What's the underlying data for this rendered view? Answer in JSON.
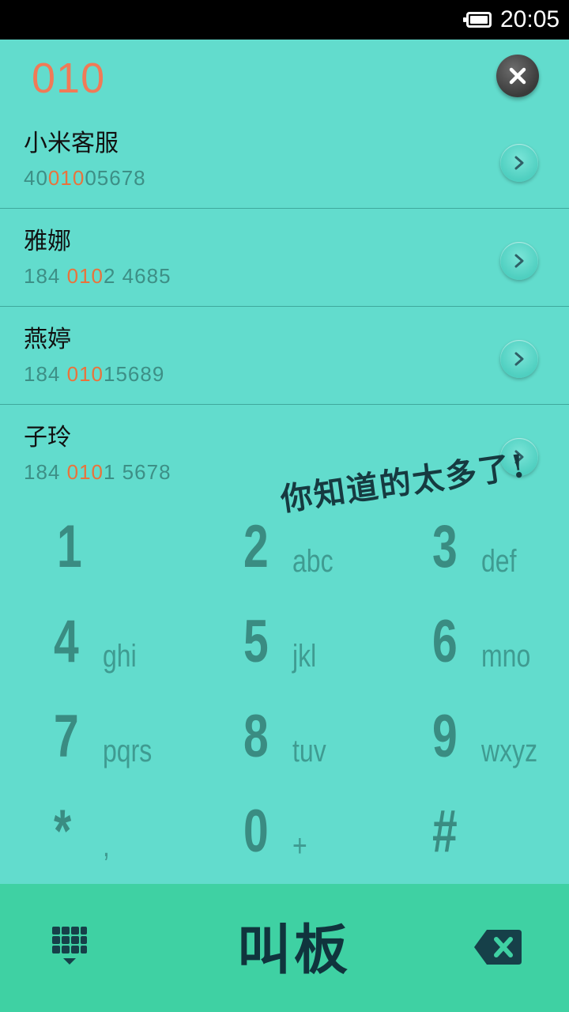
{
  "status_bar": {
    "time": "20:05",
    "battery_icon": "battery-full-icon"
  },
  "search": {
    "query": "010"
  },
  "contacts": [
    {
      "name": "小米客服",
      "number_prefix": "40",
      "number_match": "010",
      "number_suffix": "05678"
    },
    {
      "name": "雅娜",
      "number_prefix": "184 ",
      "number_match": "010",
      "number_suffix": "2 4685"
    },
    {
      "name": "燕婷",
      "number_prefix": "184 ",
      "number_match": "010",
      "number_suffix": "15689"
    },
    {
      "name": "子玲",
      "number_prefix": "184 ",
      "number_match": "010",
      "number_suffix": "1 5678"
    }
  ],
  "keypad": [
    {
      "digit": "1",
      "letters": ""
    },
    {
      "digit": "2",
      "letters": "abc"
    },
    {
      "digit": "3",
      "letters": "def"
    },
    {
      "digit": "4",
      "letters": "ghi"
    },
    {
      "digit": "5",
      "letters": "jkl"
    },
    {
      "digit": "6",
      "letters": "mno"
    },
    {
      "digit": "7",
      "letters": "pqrs"
    },
    {
      "digit": "8",
      "letters": "tuv"
    },
    {
      "digit": "9",
      "letters": "wxyz"
    },
    {
      "digit": "*",
      "letters": ","
    },
    {
      "digit": "0",
      "letters": "+"
    },
    {
      "digit": "#",
      "letters": ""
    }
  ],
  "overlay": {
    "text": "你知道的太多了!"
  },
  "bottom_bar": {
    "brand": "叫板"
  },
  "colors": {
    "background": "#62dccd",
    "bottom_bar": "#3fd1a3",
    "highlight": "#e9733c",
    "query": "#f07a57"
  }
}
